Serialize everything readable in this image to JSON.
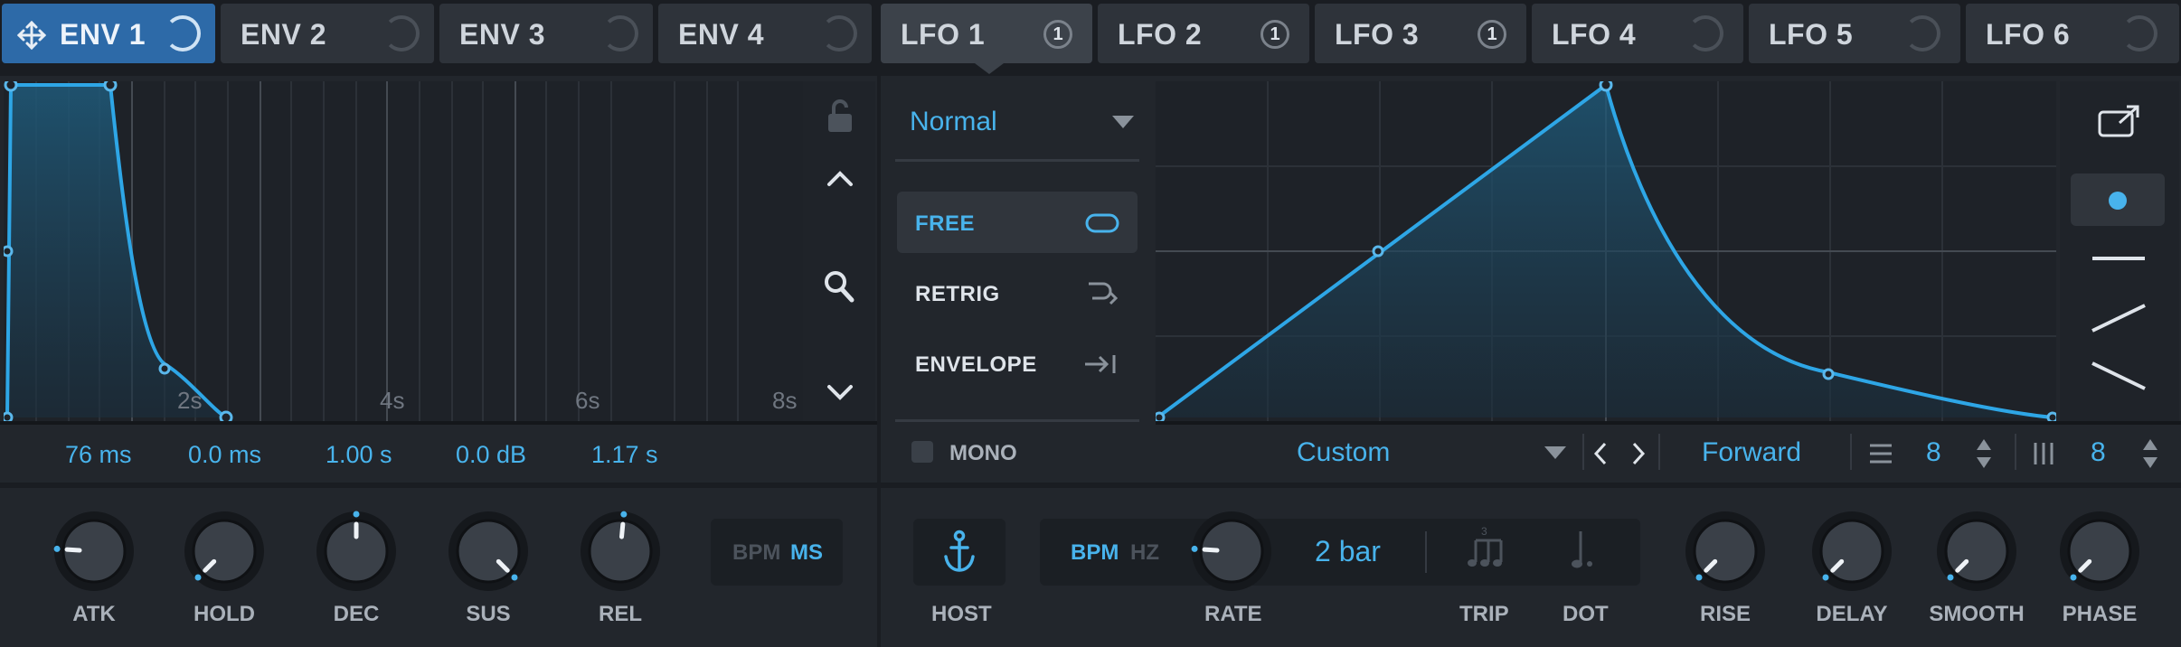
{
  "env_tabs": [
    {
      "label": "ENV 1",
      "active": true
    },
    {
      "label": "ENV 2",
      "active": false
    },
    {
      "label": "ENV 3",
      "active": false
    },
    {
      "label": "ENV 4",
      "active": false
    }
  ],
  "lfo_tabs": [
    {
      "label": "LFO 1",
      "badge": "1",
      "active": true
    },
    {
      "label": "LFO 2",
      "badge": "1",
      "active": false
    },
    {
      "label": "LFO 3",
      "badge": "1",
      "active": false
    },
    {
      "label": "LFO 4",
      "badge": "",
      "active": false
    },
    {
      "label": "LFO 5",
      "badge": "",
      "active": false
    },
    {
      "label": "LFO 6",
      "badge": "",
      "active": false
    }
  ],
  "envelope": {
    "time_labels": [
      "2s",
      "4s",
      "6s",
      "8s"
    ],
    "values": [
      "76 ms",
      "0.0 ms",
      "1.00 s",
      "0.0 dB",
      "1.17 s"
    ],
    "knobs": [
      {
        "label": "ATK",
        "value": 0.18
      },
      {
        "label": "HOLD",
        "value": 0.0
      },
      {
        "label": "DEC",
        "value": 0.5
      },
      {
        "label": "SUS",
        "value": 1.0
      },
      {
        "label": "REL",
        "value": 0.52
      }
    ],
    "time_mode": {
      "bpm": "BPM",
      "ms": "MS",
      "selected": "MS"
    }
  },
  "lfo": {
    "mode_select": "Normal",
    "trigger_modes": [
      {
        "label": "FREE",
        "selected": true
      },
      {
        "label": "RETRIG",
        "selected": false
      },
      {
        "label": "ENVELOPE",
        "selected": false
      }
    ],
    "mono_label": "MONO",
    "mono_checked": false,
    "shape_preset": "Custom",
    "direction": "Forward",
    "grid_x": "8",
    "grid_y": "8",
    "host_label": "HOST",
    "rate_mode": {
      "bpm": "BPM",
      "hz": "HZ",
      "selected": "BPM"
    },
    "rate_value": "2 bar",
    "rate_label": "RATE",
    "trip_label": "TRIP",
    "dot_label": "DOT",
    "knobs": [
      {
        "label": "RISE",
        "value": 0.0
      },
      {
        "label": "DELAY",
        "value": 0.0
      },
      {
        "label": "SMOOTH",
        "value": 0.0
      },
      {
        "label": "PHASE",
        "value": 0.0
      }
    ],
    "rate_knob_value": 0.18
  },
  "colors": {
    "accent": "#48b3ec",
    "active_tab": "#2d6aa8",
    "panel": "#22262c",
    "background": "#1a1d22"
  }
}
